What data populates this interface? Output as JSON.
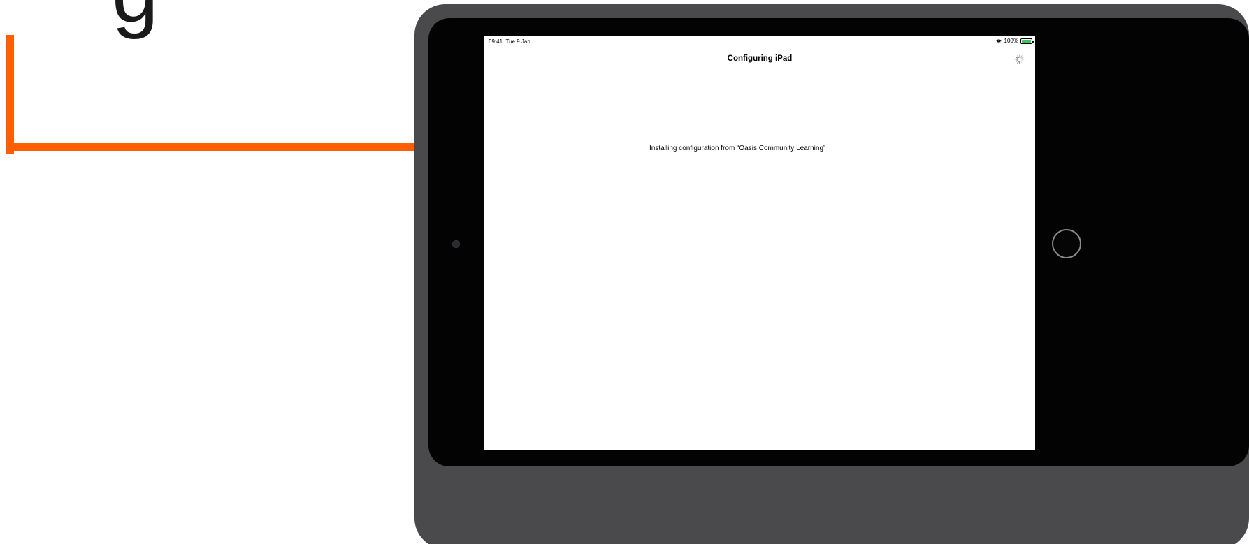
{
  "heading_fragment": "g",
  "status_bar": {
    "time": "09:41",
    "date": "Tue 9 Jan",
    "battery": "100%"
  },
  "nav": {
    "title": "Configuring iPad"
  },
  "content": {
    "message": "Installing configuration from “Oasis Community Learning”"
  },
  "colors": {
    "callout_arrow": "#ff5f00",
    "device_frame": "#4a4a4d",
    "battery_fill": "#34c759"
  },
  "icons": {
    "wifi": "wifi-icon",
    "battery": "battery-icon",
    "spinner": "activity-spinner-icon",
    "arrow": "callout-arrow"
  }
}
